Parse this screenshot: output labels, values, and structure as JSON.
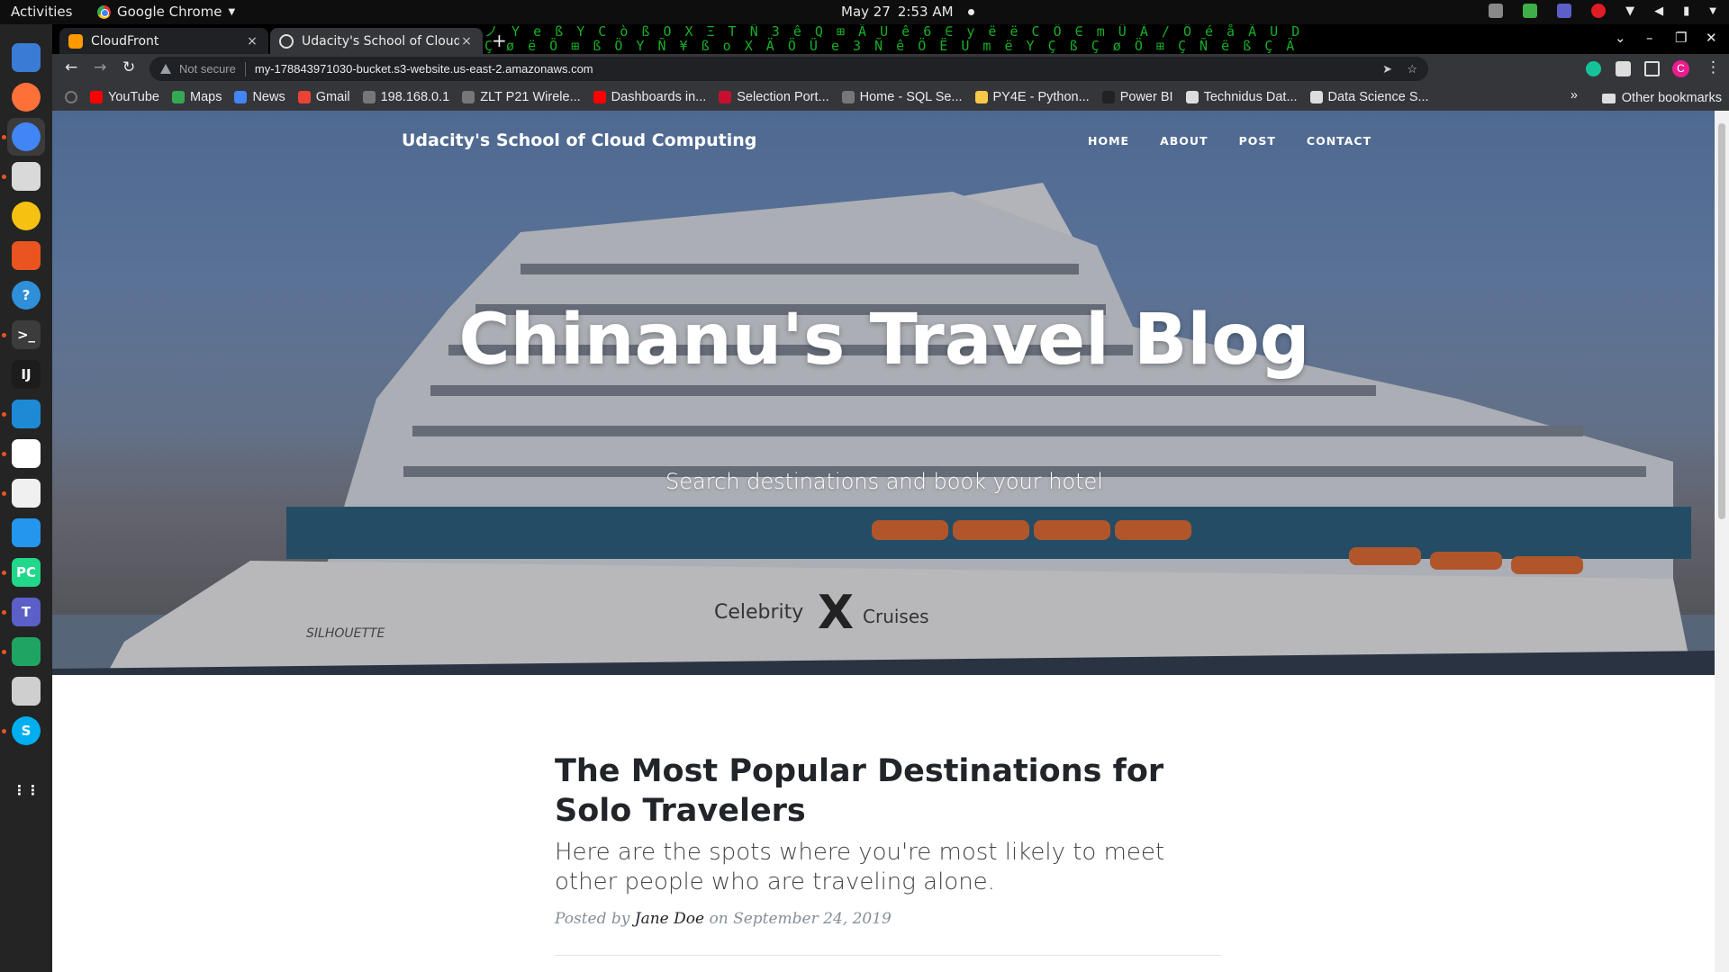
{
  "topbar": {
    "activities": "Activities",
    "app_name": "Google Chrome",
    "date": "May 27",
    "time": "2:53 AM"
  },
  "dock": {
    "items": [
      {
        "name": "thunderbird",
        "color": "#3a7bd5"
      },
      {
        "name": "firefox",
        "color": "#ff7139"
      },
      {
        "name": "chrome",
        "color": "#4285f4"
      },
      {
        "name": "files",
        "color": "#d9d9d9"
      },
      {
        "name": "rhythmbox",
        "color": "#f5c211"
      },
      {
        "name": "software",
        "color": "#e95420"
      },
      {
        "name": "help",
        "color": "#2f8fd8"
      },
      {
        "name": "terminal",
        "color": "#3c3c3c"
      },
      {
        "name": "intellij",
        "color": "#1c1c1c"
      },
      {
        "name": "vscode",
        "color": "#1e8ad6"
      },
      {
        "name": "slack",
        "color": "#ffffff"
      },
      {
        "name": "text-editor",
        "color": "#f0f0f0"
      },
      {
        "name": "docker",
        "color": "#2496ed"
      },
      {
        "name": "pycharm",
        "color": "#21d789"
      },
      {
        "name": "teams",
        "color": "#5b5fc7"
      },
      {
        "name": "sheets",
        "color": "#1fa463"
      },
      {
        "name": "usb",
        "color": "#cfcfcf"
      },
      {
        "name": "skype",
        "color": "#00aff0"
      },
      {
        "name": "app-grid",
        "color": "#ffffff"
      }
    ]
  },
  "tabs": [
    {
      "title": "CloudFront",
      "close": "×"
    },
    {
      "title": "Udacity's School of Cloud",
      "close": "×"
    }
  ],
  "tabstrip": {
    "new_tab": "+",
    "matrix_rows": [
      "ノ Y e ß Y C ò ß O X Ξ T Ñ 3 ê Q ⊞ Ä U ê 6 ∈ y ë ë C Ö ∈ m Ü Ã / Ö é å Ä U D",
      "Ç ø ë Ö ⊞ ß Ö Y Ñ ¥ ß o X Ä Ö Ü e 3 Ñ ê Ö Ë U m ë Y Ç ß Ç ø Ö ⊞ Ç Ñ ë ß Ç Ä"
    ]
  },
  "toolbar": {
    "not_secure": "Not secure",
    "url": "my-178843971030-bucket.s3-website.us-east-2.amazonaws.com",
    "profile_initial": "C"
  },
  "bookmarks": [
    {
      "label": "YouTube",
      "color": "#ff0000"
    },
    {
      "label": "Maps",
      "color": "#34a853"
    },
    {
      "label": "News",
      "color": "#4285f4"
    },
    {
      "label": "Gmail",
      "color": "#ea4335"
    },
    {
      "label": "198.168.0.1",
      "color": "#777777"
    },
    {
      "label": "ZLT P21 Wirele...",
      "color": "#777777"
    },
    {
      "label": "Dashboards in...",
      "color": "#ff0000"
    },
    {
      "label": "Selection Port...",
      "color": "#c8102e"
    },
    {
      "label": "Home - SQL Se...",
      "color": "#777777"
    },
    {
      "label": "PY4E - Python...",
      "color": "#f7c948"
    },
    {
      "label": "Power BI",
      "color": "#222222"
    },
    {
      "label": "Technidus Dat...",
      "color": "#dddddd"
    },
    {
      "label": "Data Science S...",
      "color": "#dddddd"
    }
  ],
  "bookmarks_more": "»",
  "other_bookmarks": "Other bookmarks",
  "site": {
    "brand": "Udacity's School of Cloud Computing",
    "nav": [
      "HOME",
      "ABOUT",
      "POST",
      "CONTACT"
    ],
    "hero_title": "Chinanu's Travel Blog",
    "hero_subtitle": "Search destinations and book your hotel",
    "ship_text_1": "Celebrity",
    "ship_text_2": "Cruises",
    "ship_name": "SILHOUETTE"
  },
  "post": {
    "title": "The Most Popular Destinations for Solo Travelers",
    "subtitle": "Here are the spots where you're most likely to meet other people who are traveling alone.",
    "posted_by": "Posted by",
    "author": "Jane Doe",
    "on": "on September 24, 2019"
  }
}
